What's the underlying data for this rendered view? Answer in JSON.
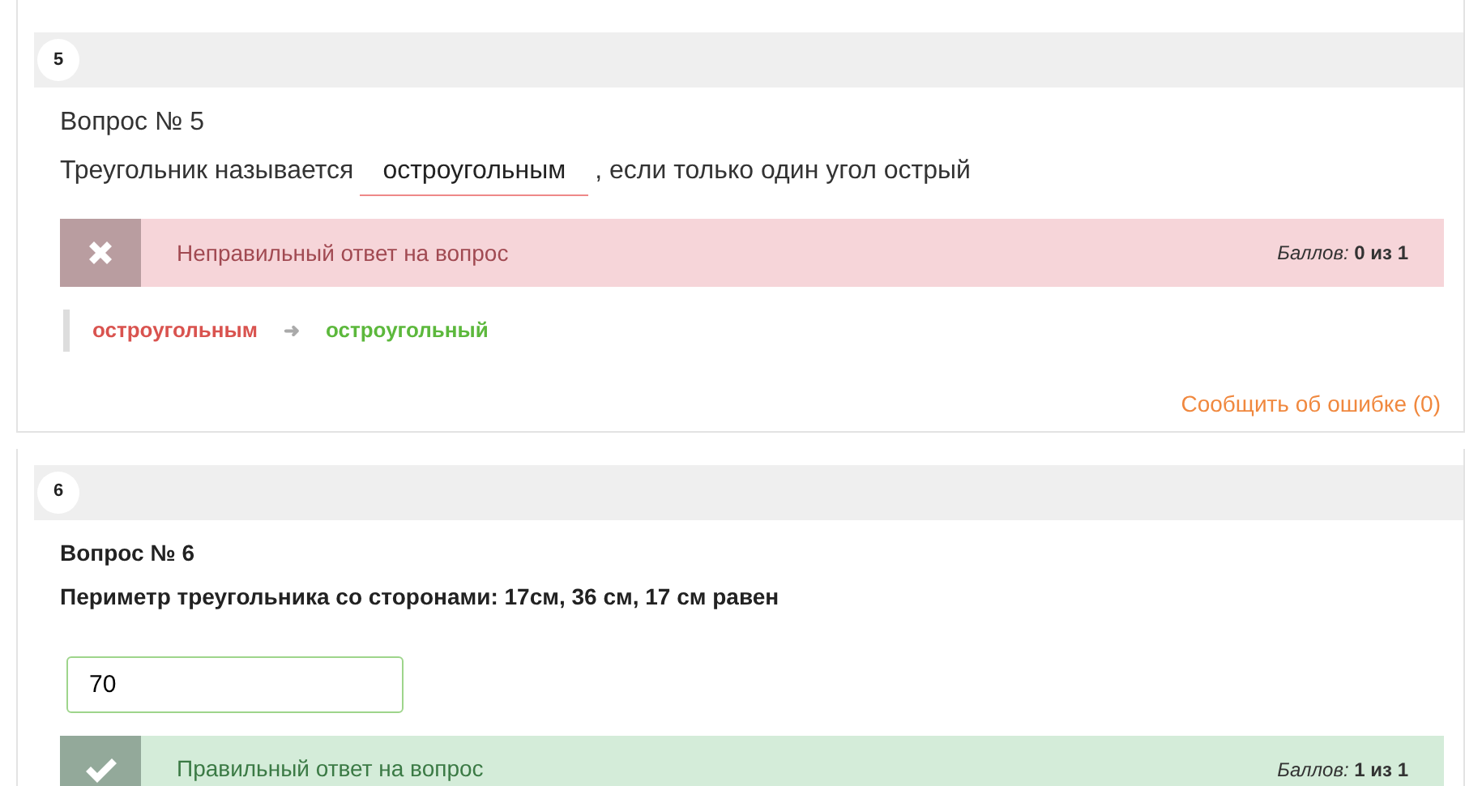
{
  "questions": [
    {
      "kind": "fill_blank",
      "number": "5",
      "title": "Вопрос № 5",
      "text_before": "Треугольник называется",
      "answer": "остроугольным",
      "text_after": ", если только один угол острый",
      "result": {
        "correct": false,
        "message": "Неправильный ответ на вопрос",
        "score": "*Баллов:* **0 из 1**"
      },
      "correction": {
        "given": "остроугольным",
        "arrow": "➜",
        "expected": "остроугольный"
      },
      "report_link": "Сообщить об ошибке (0)"
    },
    {
      "kind": "input",
      "number": "6",
      "title": "Вопрос № 6",
      "text": "Периметр треугольника со сторонами: 17см, 36 см, 17 см равен",
      "answer": "70",
      "result": {
        "correct": true,
        "message": "Правильный ответ на вопрос",
        "score": "*Баллов:* **1 из 1**"
      }
    }
  ]
}
